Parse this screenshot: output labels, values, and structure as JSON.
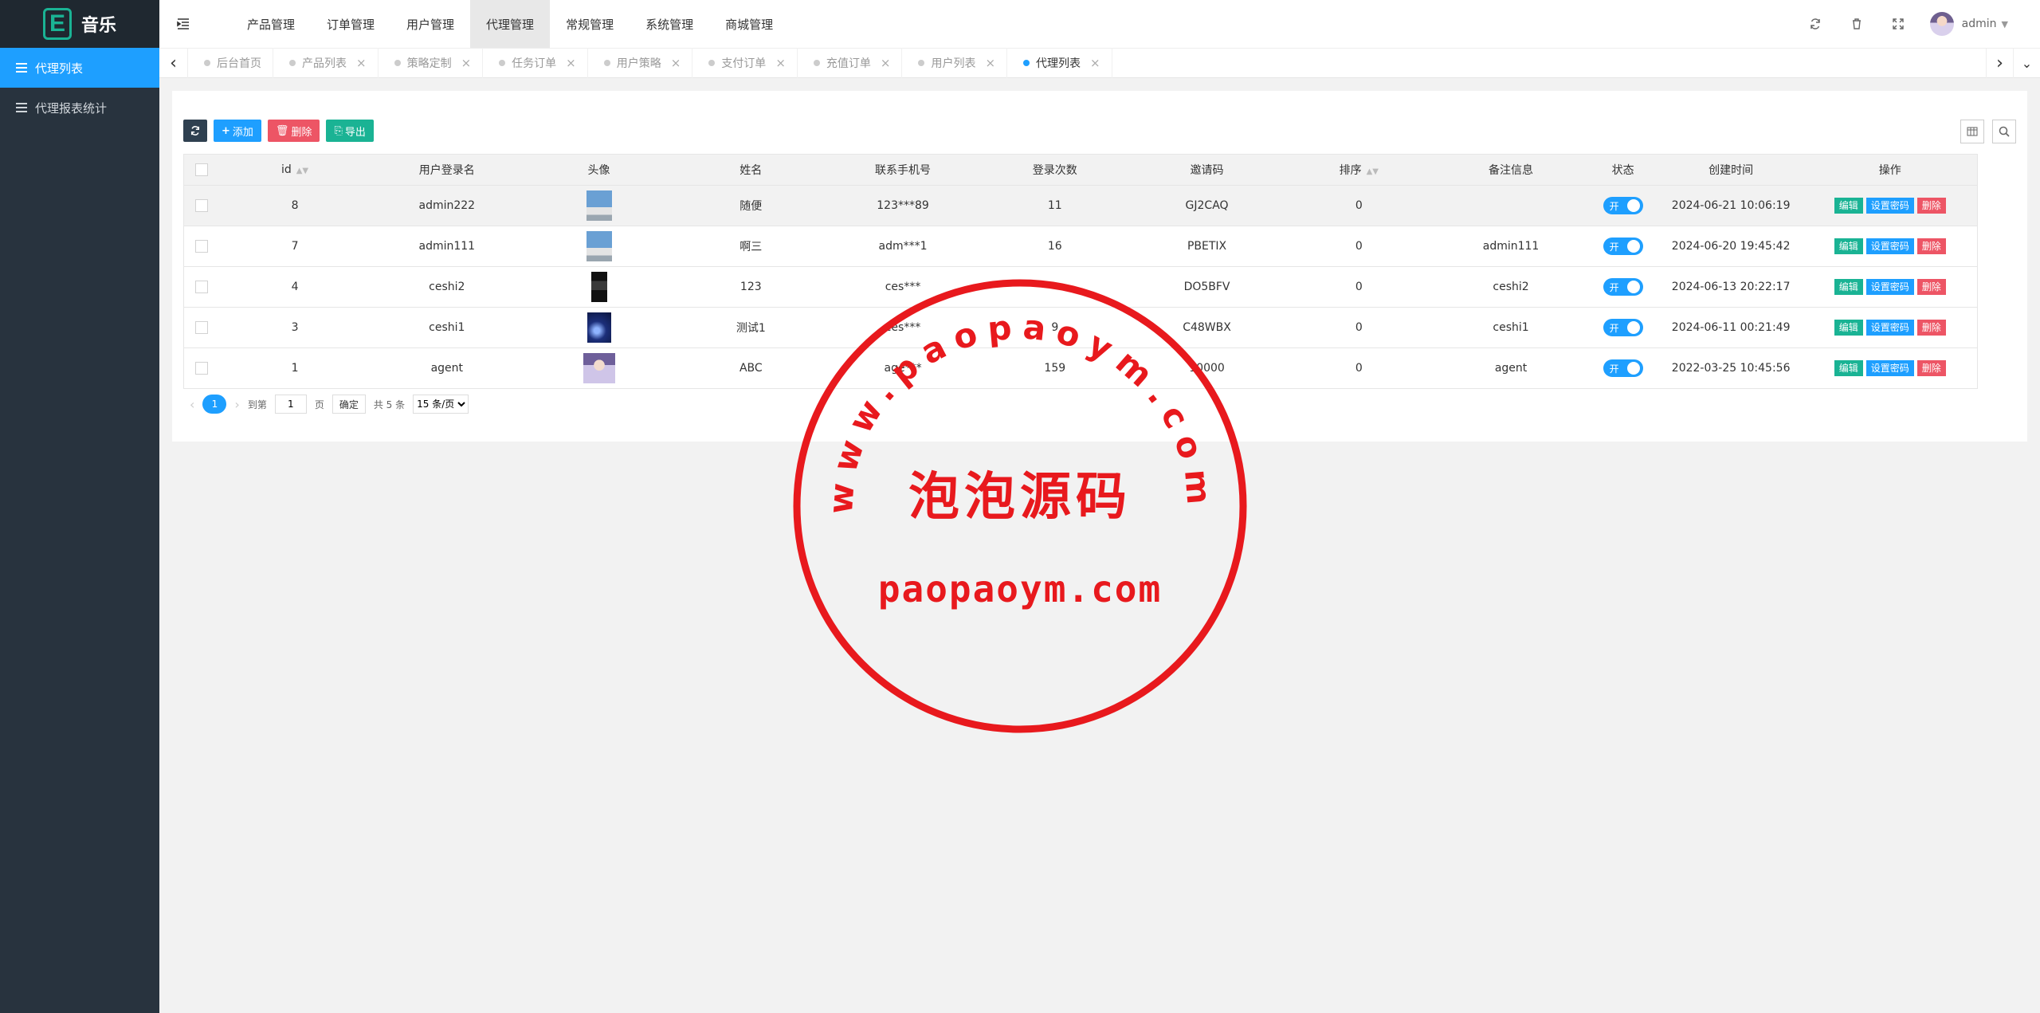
{
  "app": {
    "logo_letter": "E",
    "name": "音乐"
  },
  "sidebar": {
    "items": [
      {
        "label": "代理列表",
        "active": true
      },
      {
        "label": "代理报表统计",
        "active": false
      }
    ]
  },
  "header": {
    "toggle_icon": "menu-fold-icon",
    "nav": [
      {
        "label": "产品管理"
      },
      {
        "label": "订单管理"
      },
      {
        "label": "用户管理"
      },
      {
        "label": "代理管理",
        "active": true
      },
      {
        "label": "常规管理"
      },
      {
        "label": "系统管理"
      },
      {
        "label": "商城管理"
      }
    ],
    "icons": [
      "refresh-icon",
      "trash-icon",
      "fullscreen-icon"
    ],
    "user": "admin"
  },
  "tabs": [
    {
      "label": "后台首页",
      "closable": false
    },
    {
      "label": "产品列表",
      "closable": true
    },
    {
      "label": "策略定制",
      "closable": true
    },
    {
      "label": "任务订单",
      "closable": true
    },
    {
      "label": "用户策略",
      "closable": true
    },
    {
      "label": "支付订单",
      "closable": true
    },
    {
      "label": "充值订单",
      "closable": true
    },
    {
      "label": "用户列表",
      "closable": true
    },
    {
      "label": "代理列表",
      "closable": true,
      "active": true
    }
  ],
  "toolbar": {
    "add": "添加",
    "delete": "删除",
    "export": "导出"
  },
  "table": {
    "columns": [
      "id",
      "用户登录名",
      "头像",
      "姓名",
      "联系手机号",
      "登录次数",
      "邀请码",
      "排序",
      "备注信息",
      "状态",
      "创建时间",
      "操作"
    ],
    "rows": [
      {
        "id": "8",
        "username": "admin222",
        "name": "随便",
        "phone": "123***89",
        "logins": "11",
        "code": "GJ2CAQ",
        "sort": "0",
        "remark": "",
        "status": "开",
        "created": "2024-06-21 10:06:19"
      },
      {
        "id": "7",
        "username": "admin111",
        "name": "啊三",
        "phone": "adm***1",
        "logins": "16",
        "code": "PBETIX",
        "sort": "0",
        "remark": "admin111",
        "status": "开",
        "created": "2024-06-20 19:45:42"
      },
      {
        "id": "4",
        "username": "ceshi2",
        "name": "123",
        "phone": "ces***",
        "logins": "",
        "code": "DO5BFV",
        "sort": "0",
        "remark": "ceshi2",
        "status": "开",
        "created": "2024-06-13 20:22:17"
      },
      {
        "id": "3",
        "username": "ceshi1",
        "name": "测试1",
        "phone": "ces***",
        "logins": "9",
        "code": "C48WBX",
        "sort": "0",
        "remark": "ceshi1",
        "status": "开",
        "created": "2024-06-11 00:21:49"
      },
      {
        "id": "1",
        "username": "agent",
        "name": "ABC",
        "phone": "age***",
        "logins": "159",
        "code": "10000",
        "sort": "0",
        "remark": "agent",
        "status": "开",
        "created": "2022-03-25 10:45:56"
      }
    ],
    "actions": {
      "edit": "编辑",
      "set_password": "设置密码",
      "delete": "删除"
    }
  },
  "pager": {
    "current": "1",
    "goto_label": "到第",
    "goto_value": "1",
    "page_unit": "页",
    "confirm": "确定",
    "total": "共 5 条",
    "per_page": "15 条/页"
  },
  "watermark": {
    "url_text": "www.paopaoym.com",
    "cn_text": "泡泡源码",
    "domain_text": "paopaoym.com",
    "color": "#e8191d"
  }
}
